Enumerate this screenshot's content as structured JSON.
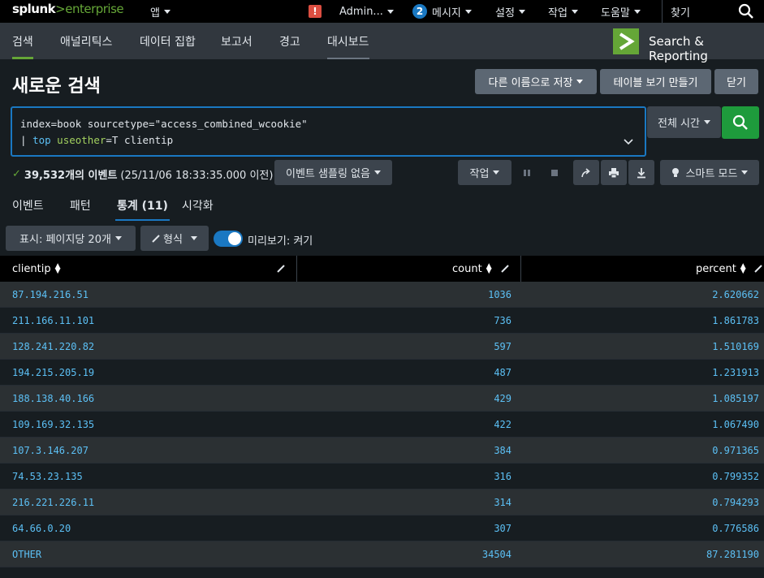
{
  "topbar": {
    "logo_main": "splunk",
    "logo_gt": ">",
    "logo_product": "enterprise",
    "app_menu": "앱",
    "alert_symbol": "!",
    "admin_menu": "Admin...",
    "messages_count": "2",
    "messages_menu": "메시지",
    "settings_menu": "설정",
    "activity_menu": "작업",
    "help_menu": "도움말",
    "find_label": "찾기"
  },
  "appbar": {
    "tabs": [
      {
        "label": "검색"
      },
      {
        "label": "애널리틱스"
      },
      {
        "label": "데이터 집합"
      },
      {
        "label": "보고서"
      },
      {
        "label": "경고"
      },
      {
        "label": "대시보드"
      }
    ],
    "app_name": "Search & Reporting",
    "accent": "#65a637"
  },
  "page": {
    "title": "새로운 검색",
    "save_as_label": "다른 이름으로 저장",
    "create_table_label": "테이블 보기 만들기",
    "close_label": "닫기"
  },
  "search": {
    "line1": "index=book sourcetype=\"access_combined_wcookie\"",
    "line2_pipe": "| ",
    "line2_cmd": "top",
    "line2_arg": "useother",
    "line2_rest": "=T clientip",
    "time_range": "전체 시간"
  },
  "status": {
    "check": "✓",
    "event_count": "39,532개의 이벤트",
    "time_note": "(25/11/06 18:33:35.000 이전)",
    "sampling_label": "이벤트 샘플링 없음",
    "job_label": "작업",
    "smart_mode_label": "스마트 모드"
  },
  "result_tabs": [
    {
      "label": "이벤트"
    },
    {
      "label": "패턴"
    },
    {
      "label": "통계 (11)"
    },
    {
      "label": "시각화"
    }
  ],
  "options": {
    "per_page_label": "표시: 페이지당 20개",
    "format_label": "형식",
    "preview_label": "미리보기: 켜기"
  },
  "table": {
    "columns": [
      "clientip",
      "count",
      "percent"
    ],
    "rows": [
      [
        "87.194.216.51",
        "1036",
        "2.620662"
      ],
      [
        "211.166.11.101",
        "736",
        "1.861783"
      ],
      [
        "128.241.220.82",
        "597",
        "1.510169"
      ],
      [
        "194.215.205.19",
        "487",
        "1.231913"
      ],
      [
        "188.138.40.166",
        "429",
        "1.085197"
      ],
      [
        "109.169.32.135",
        "422",
        "1.067490"
      ],
      [
        "107.3.146.207",
        "384",
        "0.971365"
      ],
      [
        "74.53.23.135",
        "316",
        "0.799352"
      ],
      [
        "216.221.226.11",
        "314",
        "0.794293"
      ],
      [
        "64.66.0.20",
        "307",
        "0.776586"
      ],
      [
        "OTHER",
        "34504",
        "87.281190"
      ]
    ]
  },
  "colors": {
    "link": "#5cc0f5",
    "primary": "#1a78c2",
    "go": "#1e9b3c"
  }
}
